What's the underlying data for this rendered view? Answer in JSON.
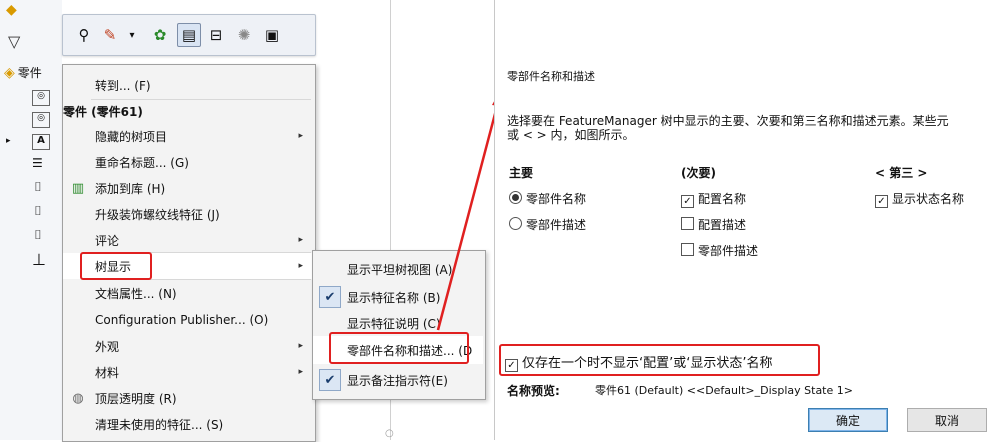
{
  "toolbar": {
    "icons": [
      "zoom-icon",
      "appearance-icon",
      "dropdown-arrow-icon",
      "scene-icon",
      "display-pane-icon",
      "tree-display-icon",
      "lights-icon",
      "view-settings-icon"
    ]
  },
  "tree": {
    "root_label": "零件"
  },
  "context_menu": {
    "items": [
      {
        "label": "转到... (F)",
        "type": "item"
      },
      {
        "label": "零件 (零件61)",
        "type": "header"
      },
      {
        "label": "隐藏的树项目",
        "type": "submenu"
      },
      {
        "label": "重命名标题... (G)",
        "type": "item"
      },
      {
        "label": "添加到库 (H)",
        "type": "item",
        "icon": "library-icon"
      },
      {
        "label": "升级装饰螺纹线特征 (J)",
        "type": "item"
      },
      {
        "label": "评论",
        "type": "submenu"
      },
      {
        "label": "树显示",
        "type": "submenu"
      },
      {
        "label": "文档属性... (N)",
        "type": "item"
      },
      {
        "label": "Configuration Publisher... (O)",
        "type": "item"
      },
      {
        "label": "外观",
        "type": "submenu"
      },
      {
        "label": "材料",
        "type": "submenu"
      },
      {
        "label": "顶层透明度 (R)",
        "type": "item",
        "icon": "transparency-icon"
      },
      {
        "label": "清理未使用的特征... (S)",
        "type": "item"
      }
    ]
  },
  "tree_display_submenu": {
    "items": [
      {
        "label": "显示平坦树视图 (A)",
        "checked": false
      },
      {
        "label": "显示特征名称 (B)",
        "checked": true
      },
      {
        "label": "显示特征说明 (C)",
        "checked": false
      },
      {
        "label": "零部件名称和描述... (D",
        "checked": false
      },
      {
        "label": "显示备注指示符(E)",
        "checked": true
      }
    ]
  },
  "dialog": {
    "title": "零部件名称和描述",
    "description_line1": "选择要在 FeatureManager 树中显示的主要、次要和第三名称和描述元素。某些元",
    "description_line2": "或 < > 内，如图所示。",
    "primary": {
      "header": "主要",
      "options": [
        {
          "label": "零部件名称",
          "selected": true
        },
        {
          "label": "零部件描述",
          "selected": false
        }
      ]
    },
    "secondary": {
      "header": "(次要)",
      "options": [
        {
          "label": "配置名称",
          "checked": true
        },
        {
          "label": "配置描述",
          "checked": false
        },
        {
          "label": "零部件描述",
          "checked": false
        }
      ]
    },
    "tertiary": {
      "header": "< 第三 >",
      "options": [
        {
          "label": "显示状态名称",
          "checked": true
        }
      ]
    },
    "only_when_multiple": {
      "label": "仅存在一个时不显示‘配置’或‘显示状态’名称",
      "checked": true
    },
    "preview_label": "名称预览:",
    "preview_value": "零件61 (Default) <<Default>_Display State 1>",
    "ok_label": "确定",
    "cancel_label": "取消"
  },
  "colors": {
    "highlight": "#e02020",
    "menu_bg": "#f3f3f3",
    "check_bg": "#dbe6f4"
  }
}
